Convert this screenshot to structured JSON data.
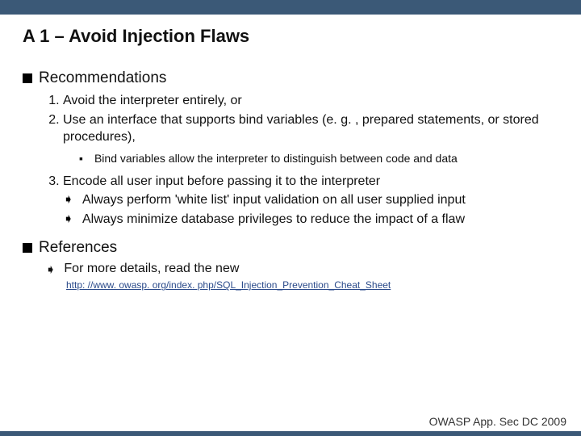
{
  "title": "A 1 – Avoid Injection Flaws",
  "sections": {
    "recommendations": {
      "heading": "Recommendations",
      "items": {
        "n1": "Avoid the interpreter entirely, or",
        "n2": "Use an interface that supports bind variables (e. g. , prepared statements, or stored procedures),",
        "sub1": "Bind variables allow the interpreter to distinguish between code and data",
        "n3": "Encode all user input before passing it to the interpreter",
        "a1": "Always perform 'white list' input validation on all user supplied input",
        "a2": "Always minimize database privileges to reduce the impact of a flaw"
      }
    },
    "references": {
      "heading": "References",
      "lead": "For more details, read the new",
      "link": "http: //www. owasp. org/index. php/SQL_Injection_Prevention_Cheat_Sheet"
    }
  },
  "footer": "OWASP App. Sec DC 2009",
  "glyphs": {
    "square_bullet": "▪",
    "arrow": "➧"
  }
}
